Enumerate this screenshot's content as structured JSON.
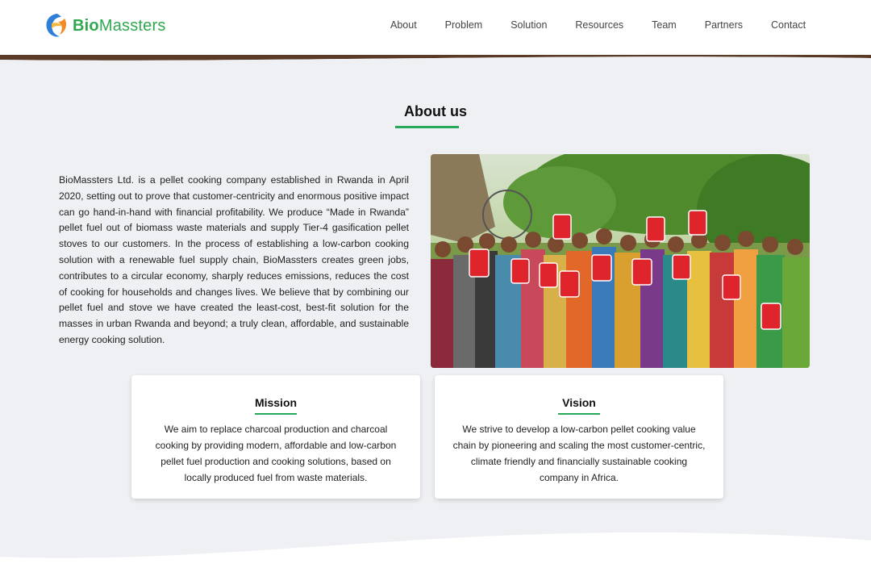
{
  "brand": {
    "name_part1": "Bio",
    "name_part2": "Massters"
  },
  "nav": [
    "About",
    "Problem",
    "Solution",
    "Resources",
    "Team",
    "Partners",
    "Contact"
  ],
  "about": {
    "title": "About us",
    "body": "BioMassters Ltd. is a pellet cooking company established in Rwanda in April 2020, setting out to prove that customer-centricity and enormous positive impact can go hand-in-hand with financial profitability. We produce “Made in Rwanda” pellet fuel out of biomass waste materials and supply Tier-4 gasification pellet stoves to our customers. In the process of establishing a low-carbon cooking solution with a renewable fuel supply chain, BioMassters creates green jobs, contributes to a circular economy, sharply reduces emissions, reduces the cost of cooking for households and changes lives. We believe that by combining our pellet fuel and stove we have created the least-cost, best-fit solution for the masses in urban Rwanda and beyond; a truly clean, affordable, and sustainable energy cooking solution."
  },
  "mission": {
    "title": "Mission",
    "body": "We aim to replace charcoal production and charcoal cooking by providing modern, affordable and low-carbon pellet fuel production and cooking solutions, based on locally produced fuel from waste materials."
  },
  "vision": {
    "title": "Vision",
    "body": "We strive to develop a low-carbon pellet cooking value chain by pioneering and scaling the most customer-centric, climate friendly and financially sustainable cooking company in Africa."
  },
  "colors": {
    "accent_green": "#27a85a",
    "logo_orange": "#f08a24",
    "logo_blue": "#2f7fd8"
  }
}
